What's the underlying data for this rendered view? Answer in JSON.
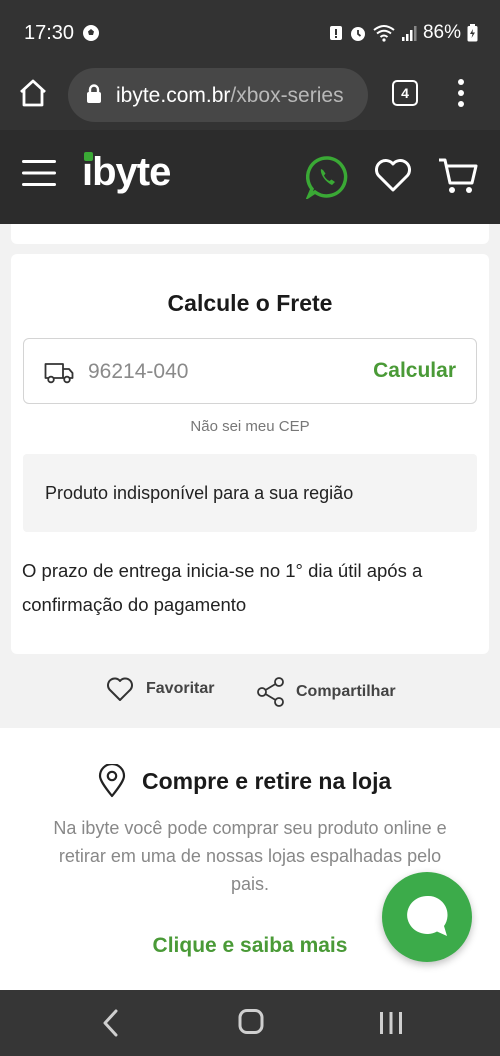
{
  "status_bar": {
    "time": "17:30",
    "battery": "86%"
  },
  "browser": {
    "url_host": "ibyte.com.br",
    "url_path": "/xbox-series",
    "tab_count": "4"
  },
  "header": {
    "logo": "ibyte",
    "brand_color": "#3aa935"
  },
  "frete": {
    "title": "Calcule o Frete",
    "cep_value": "96214-040",
    "calc_label": "Calcular",
    "dont_know_cep": "Não sei meu CEP",
    "unavailable": "Produto indisponível para a sua região",
    "prazo": "O prazo de entrega inicia-se no 1° dia útil após a confirmação do pagamento"
  },
  "actions": {
    "favorite": "Favoritar",
    "share": "Compartilhar"
  },
  "store": {
    "title": "Compre e retire na loja",
    "description": "Na ibyte você pode comprar seu produto online e retirar em uma de nossas lojas espalhadas pelo pais.",
    "link": "Clique e saiba mais"
  },
  "colors": {
    "accent_green": "#4a9a37",
    "header_bg": "#2c2c2c",
    "fab_green": "#3cab4a"
  }
}
